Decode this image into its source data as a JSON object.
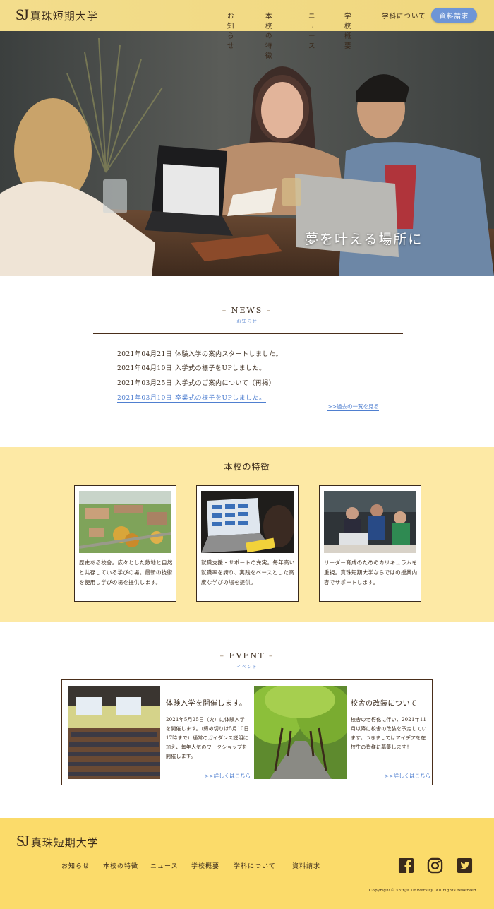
{
  "header": {
    "logo_mark": "SJ",
    "logo_name": "真珠短期大学",
    "nav": [
      "お知らせ",
      "本校の特徴",
      "ニュース",
      "学校概要",
      "学科について"
    ],
    "cta_label": "資料請求"
  },
  "hero": {
    "catchcopy": "夢を叶える場所に"
  },
  "news": {
    "title_en": "NEWS",
    "title_jp": "お知らせ",
    "items": [
      {
        "date": "2021年04月21日",
        "text": "体験入学の案内スタートしました。"
      },
      {
        "date": "2021年04月10日",
        "text": "入学式の様子をUPしました。"
      },
      {
        "date": "2021年03月25日",
        "text": "入学式のご案内について（再掲）"
      },
      {
        "date": "2021年03月10日",
        "text": "卒業式の様子をUPしました。"
      }
    ],
    "more_label": ">>過去の一覧を見る"
  },
  "features": {
    "title": "本校の特徴",
    "cards": [
      {
        "text": "歴史ある校舎。広々とした敷地と自然と共存している学びの場。最新の技術を使用し学びの場を提供します。"
      },
      {
        "text": "就職支援・サポートの充実。毎年高い就職率を誇り、実践をベースとした高度な学びの場を提供。"
      },
      {
        "text": "リーダー育成のためのカリキュラムを重視。真珠短期大学ならではの授業内容でサポートします。"
      }
    ]
  },
  "events": {
    "title_en": "EVENT",
    "title_jp": "イベント",
    "items": [
      {
        "title": "体験入学を開催します。",
        "text": "2021年5月25日（火）に体験入学を開催します。（締め切りは5月10日17時まで）通常のガイダンス説明に加え、毎年人気のワークショップを開催します。",
        "more": ">>詳しくはこちら"
      },
      {
        "title": "校舎の改装について",
        "text": "校舎の老朽化に伴い、2021年11月以降に校舎の改装を予定しています。つきましてはアイデアを在校生の皆様に募集します！",
        "more": ">>詳しくはこちら"
      }
    ]
  },
  "footer": {
    "logo_mark": "SJ",
    "logo_name": "真珠短期大学",
    "nav": [
      "お知らせ",
      "本校の特徴",
      "ニュース",
      "学校概要",
      "学科について",
      "資料請求"
    ],
    "social": [
      "facebook-icon",
      "instagram-icon",
      "twitter-icon"
    ],
    "copyright": "Copyright© shinju University. All rights reserved."
  },
  "colors": {
    "header_bg": "#f3dd8c",
    "cta": "#6e95d6",
    "features_bg": "#fde9a5",
    "footer_bg": "#fbdb6a",
    "link": "#4f7fd0",
    "text": "#3a2a1c"
  }
}
